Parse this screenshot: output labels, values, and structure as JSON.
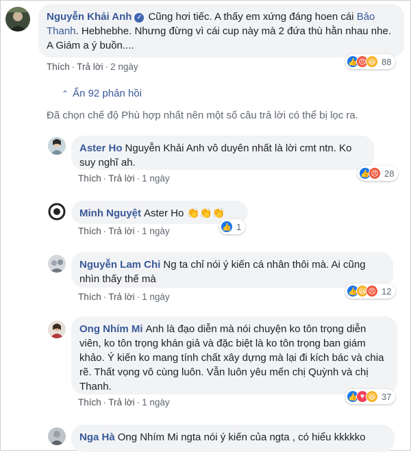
{
  "top_comment": {
    "author": "Nguyễn Khải Anh",
    "text_before": "Cũng hơi tiếc. A thấy em xứng đáng hoen cái",
    "mention": "Bảo Thanh",
    "text_after": ". Hebhebhe. Nhưng đừng vì cái cup này mà 2 đứa thù hằn nhau nhe. A Giám a ý buồn....",
    "actions": {
      "like": "Thích",
      "reply": "Trả lời",
      "time": "2 ngày"
    },
    "reaction_count": "88"
  },
  "hide_replies": "Ẩn 92 phản hồi",
  "filter_note": "Đã chọn chế độ Phù hợp nhất nên một số câu trả lời có thể bị lọc ra.",
  "replies": [
    {
      "author": "Aster Ho",
      "text": "Nguyễn Khải Anh vô duyên nhất là lời cmt ntn. Ko suy nghĩ ah.",
      "actions": {
        "like": "Thích",
        "reply": "Trả lời",
        "time": "1 ngày"
      },
      "reaction_count": "28"
    },
    {
      "author": "Minh Nguyệt",
      "text": "Aster Ho",
      "actions": {
        "like": "Thích",
        "reply": "Trả lời",
        "time": "1 ngày"
      },
      "reaction_count": "1"
    },
    {
      "author": "Nguyễn Lam Chi",
      "text": "Ng ta chỉ nói ý kiến cá nhân thôi mà. Ai cũng nhìn thấy thế mà",
      "actions": {
        "like": "Thích",
        "reply": "Trả lời",
        "time": "1 ngày"
      },
      "reaction_count": "12"
    },
    {
      "author": "Ong Nhím Mi",
      "text": "Anh là đạo diễn mà nói chuyện ko tôn trọng diễn viên, ko tôn trọng khán giả và đặc biệt là ko tôn trọng ban giám khảo. Ý kiến ko mang tính chất xây dựng mà lại đi kích bác và chia rẽ. Thất vọng vô cùng luôn. Vẫn luôn yêu mến chị Quỳnh và chị Thanh.",
      "actions": {
        "like": "Thích",
        "reply": "Trả lời",
        "time": "1 ngày"
      },
      "reaction_count": "37"
    },
    {
      "author": "Nga Hà",
      "text": "Ong Nhím Mi ngta nói ý kiến của ngta , có hiểu kkkkko"
    }
  ],
  "icons": {
    "like": "like-reaction-icon",
    "angry": "angry-reaction-icon",
    "haha": "haha-reaction-icon",
    "love": "love-reaction-icon",
    "clap": "clapping-hands-icon",
    "verified": "verified-badge-icon",
    "chevron": "chevron-up-icon"
  },
  "colors": {
    "link": "#385898",
    "bubble": "#f2f3f5",
    "like": "#1877f2",
    "angry": "#f0573c",
    "haha": "#f7b125",
    "love": "#f33e58"
  }
}
